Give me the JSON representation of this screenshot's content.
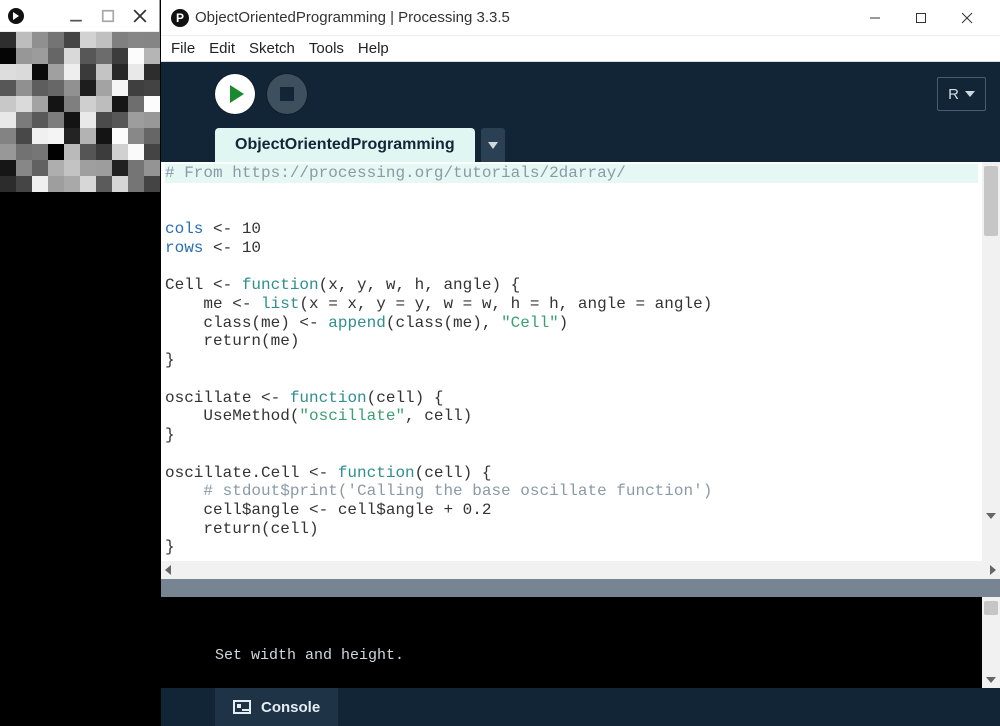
{
  "sketchWindow": {
    "gridCols": 10,
    "gridRows": 10
  },
  "processing": {
    "title": "ObjectOrientedProgramming | Processing 3.3.5",
    "menus": [
      "File",
      "Edit",
      "Sketch",
      "Tools",
      "Help"
    ],
    "modeLabel": "R",
    "tabName": "ObjectOrientedProgramming"
  },
  "code": [
    {
      "hl": true,
      "tokens": [
        [
          "comment",
          "# From https://processing.org/tutorials/2darray/"
        ]
      ]
    },
    {
      "tokens": []
    },
    {
      "tokens": [
        [
          "id",
          "cols"
        ],
        [
          "plain",
          " <- 10"
        ]
      ]
    },
    {
      "tokens": [
        [
          "id",
          "rows"
        ],
        [
          "plain",
          " <- 10"
        ]
      ]
    },
    {
      "tokens": []
    },
    {
      "tokens": [
        [
          "plain",
          "Cell <- "
        ],
        [
          "kw",
          "function"
        ],
        [
          "plain",
          "(x, y, w, h, angle) {"
        ]
      ]
    },
    {
      "tokens": [
        [
          "plain",
          "    me <- "
        ],
        [
          "kw",
          "list"
        ],
        [
          "plain",
          "(x = x, y = y, w = w, h = h, angle = angle)"
        ]
      ]
    },
    {
      "tokens": [
        [
          "plain",
          "    class(me) <- "
        ],
        [
          "kw",
          "append"
        ],
        [
          "plain",
          "(class(me), "
        ],
        [
          "str",
          "\"Cell\""
        ],
        [
          "plain",
          ")"
        ]
      ]
    },
    {
      "tokens": [
        [
          "plain",
          "    return(me)"
        ]
      ]
    },
    {
      "tokens": [
        [
          "plain",
          "}"
        ]
      ]
    },
    {
      "tokens": []
    },
    {
      "tokens": [
        [
          "plain",
          "oscillate <- "
        ],
        [
          "kw",
          "function"
        ],
        [
          "plain",
          "(cell) {"
        ]
      ]
    },
    {
      "tokens": [
        [
          "plain",
          "    UseMethod("
        ],
        [
          "str",
          "\"oscillate\""
        ],
        [
          "plain",
          ", cell)"
        ]
      ]
    },
    {
      "tokens": [
        [
          "plain",
          "}"
        ]
      ]
    },
    {
      "tokens": []
    },
    {
      "tokens": [
        [
          "plain",
          "oscillate.Cell <- "
        ],
        [
          "kw",
          "function"
        ],
        [
          "plain",
          "(cell) {"
        ]
      ]
    },
    {
      "tokens": [
        [
          "plain",
          "    "
        ],
        [
          "comment",
          "# stdout$print('Calling the base oscillate function')"
        ]
      ]
    },
    {
      "tokens": [
        [
          "plain",
          "    cell$angle <- cell$angle + 0.2"
        ]
      ]
    },
    {
      "tokens": [
        [
          "plain",
          "    return(cell)"
        ]
      ]
    },
    {
      "tokens": [
        [
          "plain",
          "}"
        ]
      ]
    }
  ],
  "console": {
    "output": "Set width and height.",
    "tabLabel": "Console"
  }
}
